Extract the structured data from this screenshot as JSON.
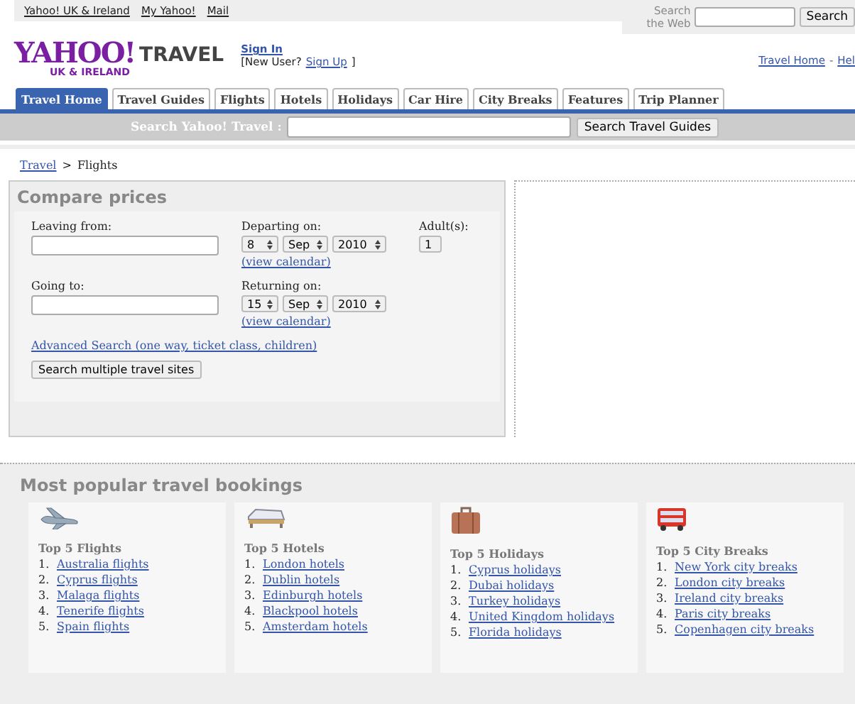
{
  "top_links": [
    "Yahoo! UK & Ireland",
    "My Yahoo!",
    "Mail"
  ],
  "web_search": {
    "label": "Search the Web",
    "button": "Search"
  },
  "logo": {
    "wordmark": "YAHOO!",
    "region": "UK & IRELAND",
    "section": "TRAVEL"
  },
  "account": {
    "sign_in": "Sign In",
    "new_user": "[New User?",
    "sign_up": "Sign Up ",
    "close": "]"
  },
  "header_links": {
    "items": [
      "Travel Home",
      "Hel"
    ],
    "separator": "-"
  },
  "tabs": [
    {
      "label": "Travel Home",
      "selected": true
    },
    {
      "label": "Travel Guides",
      "selected": false
    },
    {
      "label": "Flights",
      "selected": false
    },
    {
      "label": "Hotels",
      "selected": false
    },
    {
      "label": "Holidays",
      "selected": false
    },
    {
      "label": "Car Hire",
      "selected": false
    },
    {
      "label": "City Breaks",
      "selected": false
    },
    {
      "label": "Features",
      "selected": false
    },
    {
      "label": "Trip Planner",
      "selected": false
    }
  ],
  "search_bar": {
    "label": "Search Yahoo! Travel :",
    "button": "Search Travel Guides"
  },
  "breadcrumb": {
    "link": "Travel",
    "separator": ">",
    "current": "Flights"
  },
  "compare": {
    "title": "Compare prices",
    "leaving_label": "Leaving from:",
    "going_label": "Going to:",
    "departing": {
      "label": "Departing on:",
      "day": "8",
      "month": "Sep",
      "year": "2010",
      "calendar": "(view calendar)"
    },
    "returning": {
      "label": "Returning on:",
      "day": "15",
      "month": "Sep",
      "year": "2010",
      "calendar": "(view calendar)"
    },
    "adults": {
      "label": "Adult(s):",
      "value": "1"
    },
    "advanced": "Advanced Search (one way, ticket class, children)",
    "submit": "Search multiple travel sites"
  },
  "popular": {
    "title": "Most popular travel bookings",
    "cards": [
      {
        "title": "Top 5 Flights",
        "items": [
          {
            "number": "1.",
            "label": "Australia flights"
          },
          {
            "number": "2.",
            "label": "Cyprus flights"
          },
          {
            "number": "3.",
            "label": "Malaga flights"
          },
          {
            "number": "4.",
            "label": "Tenerife flights"
          },
          {
            "number": "5.",
            "label": "Spain flights"
          }
        ]
      },
      {
        "title": "Top 5 Hotels",
        "items": [
          {
            "number": "1.",
            "label": "London hotels"
          },
          {
            "number": "2.",
            "label": "Dublin hotels"
          },
          {
            "number": "3.",
            "label": "Edinburgh hotels"
          },
          {
            "number": "4.",
            "label": "Blackpool hotels"
          },
          {
            "number": "5.",
            "label": "Amsterdam hotels"
          }
        ]
      },
      {
        "title": "Top 5 Holidays",
        "items": [
          {
            "number": "1.",
            "label": "Cyprus holidays"
          },
          {
            "number": "2.",
            "label": "Dubai holidays"
          },
          {
            "number": "3.",
            "label": "Turkey holidays"
          },
          {
            "number": "4.",
            "label": "United Kingdom holidays"
          },
          {
            "number": "5.",
            "label": "Florida holidays"
          }
        ]
      },
      {
        "title": "Top 5 City Breaks",
        "items": [
          {
            "number": "1.",
            "label": "New York city breaks"
          },
          {
            "number": "2.",
            "label": "London city breaks"
          },
          {
            "number": "3.",
            "label": "Ireland city breaks"
          },
          {
            "number": "4.",
            "label": "Paris city breaks"
          },
          {
            "number": "5.",
            "label": "Copenhagen city breaks"
          }
        ]
      }
    ]
  }
}
